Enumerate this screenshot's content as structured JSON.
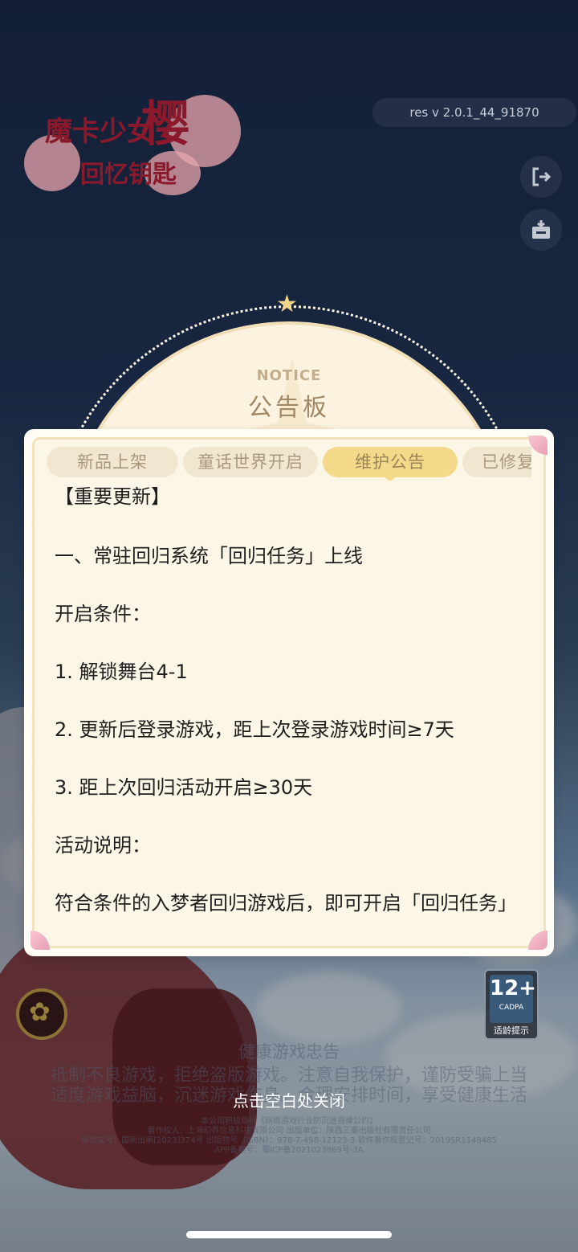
{
  "game_logo": {
    "text_main": "魔卡少女",
    "text_big": "樱",
    "text_sub": "回忆钥匙"
  },
  "version_label": "res v 2.0.1_44_91870",
  "side_buttons": {
    "logout_icon": "logout-icon",
    "notice_icon": "notice-board-icon"
  },
  "notice": {
    "title_en": "NOTICE",
    "title_zh": "公告板",
    "tabs": [
      {
        "label": "新品上架",
        "active": false
      },
      {
        "label": "童话世界开启",
        "active": false
      },
      {
        "label": "维护公告",
        "active": true
      },
      {
        "label": "已修复",
        "active": false
      }
    ],
    "content": {
      "heading": "【重要更新】",
      "section1": "一、常驻回归系统「回归任务」上线",
      "condition_title": "开启条件：",
      "cond1": "1.  解锁舞台4-1",
      "cond2": "2.  更新后登录游戏，距上次登录游戏时间≥7天",
      "cond3": "3.  距上次回归活动开启≥30天",
      "desc_title": "活动说明：",
      "desc_text": "符合条件的入梦者回归游戏后，即可开启「回归任务」"
    }
  },
  "footer": {
    "health_title": "健康游戏忠告",
    "health_line1": "抵制不良游戏，拒绝盗版游戏。注意自我保护，谨防受骗上当",
    "health_line2": "适度游戏益脑，沉迷游戏伤身。合理安排时间，享受健康生活",
    "close_tip": "点击空白处关闭",
    "legal1": "本公司积极履行《网络游戏行业防沉迷自律公约》",
    "legal2": "著作权人：上海幻界信息科技有限公司  出版单位：陕西三秦出版社有限责任公司",
    "legal3": "审批文号：国新出审[2023]374号  出版物号（ISBN）：978-7-498-12123-3  软件著作权登记号：2019SR1148485",
    "legal4": "APP备案号：蜀ICP备2021023869号-3A"
  },
  "age_rating": {
    "value": "12+",
    "org": "CADPA",
    "tip": "适龄提示"
  }
}
